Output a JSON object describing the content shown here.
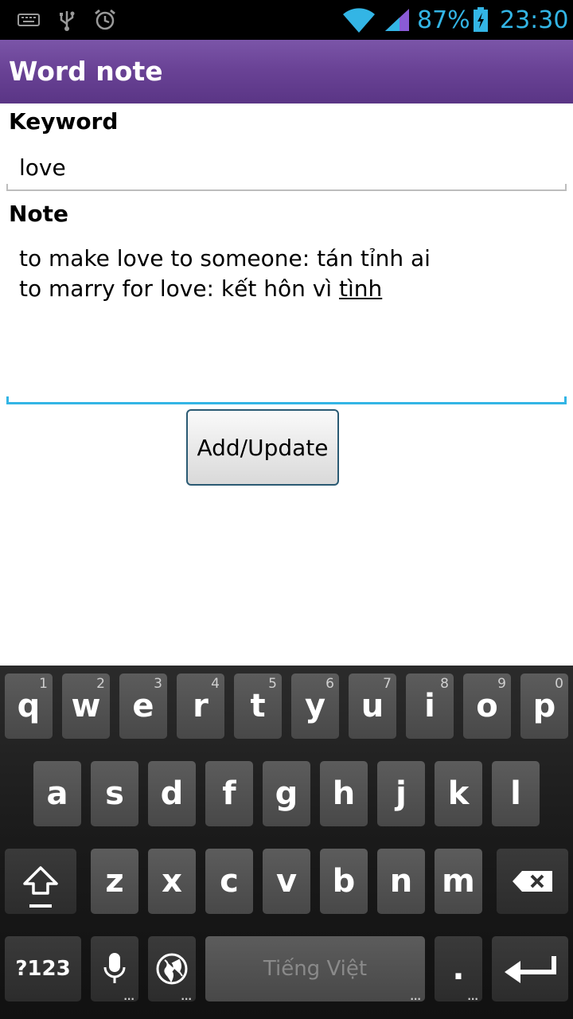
{
  "status_bar": {
    "battery_percent": "87%",
    "time": "23:30",
    "icons": [
      "keyboard-icon",
      "usb-icon",
      "alarm-icon",
      "wifi-icon",
      "signal-icon",
      "battery-charging-icon"
    ]
  },
  "action_bar": {
    "title": "Word note"
  },
  "form": {
    "keyword_label": "Keyword",
    "keyword_value": "love",
    "note_label": "Note",
    "note_line_1": "to make love to someone: tán tỉnh ai",
    "note_line_2_prefix": "to marry for love: kết hôn vì ",
    "note_line_2_underlined": "tình",
    "button_label": "Add/Update"
  },
  "keyboard": {
    "row1": [
      {
        "key": "q",
        "hint": "1"
      },
      {
        "key": "w",
        "hint": "2"
      },
      {
        "key": "e",
        "hint": "3"
      },
      {
        "key": "r",
        "hint": "4"
      },
      {
        "key": "t",
        "hint": "5"
      },
      {
        "key": "y",
        "hint": "6"
      },
      {
        "key": "u",
        "hint": "7"
      },
      {
        "key": "i",
        "hint": "8"
      },
      {
        "key": "o",
        "hint": "9"
      },
      {
        "key": "p",
        "hint": "0"
      }
    ],
    "row2": [
      "a",
      "s",
      "d",
      "f",
      "g",
      "h",
      "j",
      "k",
      "l"
    ],
    "row3": [
      "z",
      "x",
      "c",
      "v",
      "b",
      "n",
      "m"
    ],
    "symbols_label": "?123",
    "space_label": "Tiếng Việt",
    "period_label": "."
  }
}
